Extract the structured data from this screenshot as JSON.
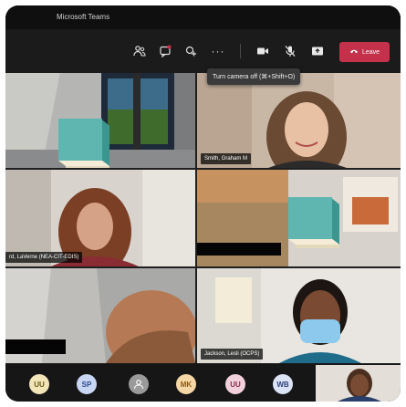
{
  "window": {
    "title": "Microsoft Teams"
  },
  "toolbar": {
    "leave_label": "Leave",
    "camera_tooltip": "Turn camera off (⌘+Shift+O)"
  },
  "participants": [
    {
      "name": "Smith, Graham M"
    },
    {
      "name": "rd, LaVerne (NEA-CIT-EDIS)"
    },
    {
      "name": "Jackson, Lesli (OCPS)"
    }
  ],
  "roster": [
    {
      "initials": "UU",
      "bg": "#f2e5b8",
      "fg": "#6b5a1a"
    },
    {
      "initials": "SP",
      "bg": "#c9d6f3",
      "fg": "#2d4a8a"
    },
    {
      "initials": "",
      "bg": "#9a9a9a",
      "fg": "#ffffff",
      "icon": "person-icon"
    },
    {
      "initials": "MK",
      "bg": "#f5d7a6",
      "fg": "#8a5a12"
    },
    {
      "initials": "UU",
      "bg": "#f3d1dc",
      "fg": "#8a2d4a"
    },
    {
      "initials": "WB",
      "bg": "#dce3f5",
      "fg": "#2d3f7a"
    }
  ],
  "colors": {
    "leave": "#c4314b",
    "book": "#5fb5b0"
  }
}
